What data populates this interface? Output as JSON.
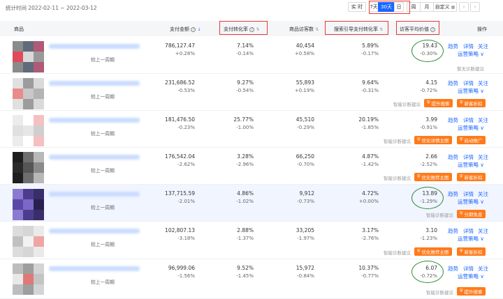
{
  "toolbar": {
    "date_range": "统计时间 2022-02-11 ~ 2022-03-12",
    "range_buttons": [
      "实 时",
      "7天",
      "30天",
      "日",
      "周",
      "月",
      "自定义"
    ],
    "active_range": "30天",
    "prev_icon": "chevron-left-icon",
    "next_icon": "chevron-right-icon"
  },
  "columns": {
    "product": "商品",
    "pay_amount": "支付金额",
    "pay_conv": "支付转化率",
    "visitors": "商品访客数",
    "search_conv": "搜索引导支付转化率",
    "avg_value": "访客平均价值",
    "actions": "操作"
  },
  "labels": {
    "compare": "较上一周期",
    "trend": "趋势",
    "detail": "详情",
    "follow": "关注",
    "ops": "运营策略",
    "diag": "智能诊断建议",
    "no_diag": "暂无诊断建议"
  },
  "rows": [
    {
      "pay_amount": "786,127.47",
      "pay_amount_chg": "+0.28%",
      "pay_conv": "7.14%",
      "pay_conv_chg": "-0.14%",
      "visitors": "40,454",
      "visitors_chg": "+0.58%",
      "search_conv": "5.89%",
      "search_conv_chg": "-0.17%",
      "avg_value": "19.43",
      "avg_value_chg": "-0.30%",
      "buttons": []
    },
    {
      "pay_amount": "231,686.52",
      "pay_amount_chg": "-0.53%",
      "pay_conv": "9.27%",
      "pay_conv_chg": "-0.54%",
      "visitors": "55,893",
      "visitors_chg": "+0.19%",
      "search_conv": "9.64%",
      "search_conv_chg": "-0.31%",
      "avg_value": "4.15",
      "avg_value_chg": "-0.72%",
      "buttons": [
        "提升搜索",
        "新客折扣"
      ]
    },
    {
      "pay_amount": "181,476.50",
      "pay_amount_chg": "-0.23%",
      "pay_conv": "25.77%",
      "pay_conv_chg": "-1.00%",
      "visitors": "45,510",
      "visitors_chg": "-0.29%",
      "search_conv": "20.19%",
      "search_conv_chg": "-1.85%",
      "avg_value": "3.99",
      "avg_value_chg": "-0.91%",
      "buttons": [
        "优化详情主图",
        "启动推广"
      ]
    },
    {
      "pay_amount": "176,542.04",
      "pay_amount_chg": "-2.62%",
      "pay_conv": "3.28%",
      "pay_conv_chg": "-2.96%",
      "visitors": "66,250",
      "visitors_chg": "-0.70%",
      "search_conv": "4.87%",
      "search_conv_chg": "-1.42%",
      "avg_value": "2.66",
      "avg_value_chg": "-2.52%",
      "buttons": [
        "优化推荐主图",
        "新客折扣"
      ]
    },
    {
      "pay_amount": "137,715.59",
      "pay_amount_chg": "-2.01%",
      "pay_conv": "4.86%",
      "pay_conv_chg": "-1.02%",
      "visitors": "9,912",
      "visitors_chg": "-0.73%",
      "search_conv": "4.72%",
      "search_conv_chg": "+0.00%",
      "avg_value": "13.89",
      "avg_value_chg": "-1.29%",
      "buttons": [
        "分期免息"
      ]
    },
    {
      "pay_amount": "102,807.13",
      "pay_amount_chg": "-3.18%",
      "pay_conv": "2.88%",
      "pay_conv_chg": "-1.37%",
      "visitors": "33,205",
      "visitors_chg": "-1.97%",
      "search_conv": "3.17%",
      "search_conv_chg": "-2.76%",
      "avg_value": "3.10",
      "avg_value_chg": "-1.23%",
      "buttons": [
        "优化推荐主图",
        "新客折扣"
      ]
    },
    {
      "pay_amount": "96,999.06",
      "pay_amount_chg": "-1.56%",
      "pay_conv": "9.52%",
      "pay_conv_chg": "-1.45%",
      "visitors": "15,972",
      "visitors_chg": "-0.84%",
      "search_conv": "10.37%",
      "search_conv_chg": "-0.77%",
      "avg_value": "6.07",
      "avg_value_chg": "-0.72%",
      "buttons": [
        "提升搜索"
      ]
    }
  ],
  "colors": {
    "accent": "#1a66ff",
    "orange": "#ff7a1a",
    "annotation_red": "#e53935",
    "annotation_green": "#2e8b3a"
  }
}
